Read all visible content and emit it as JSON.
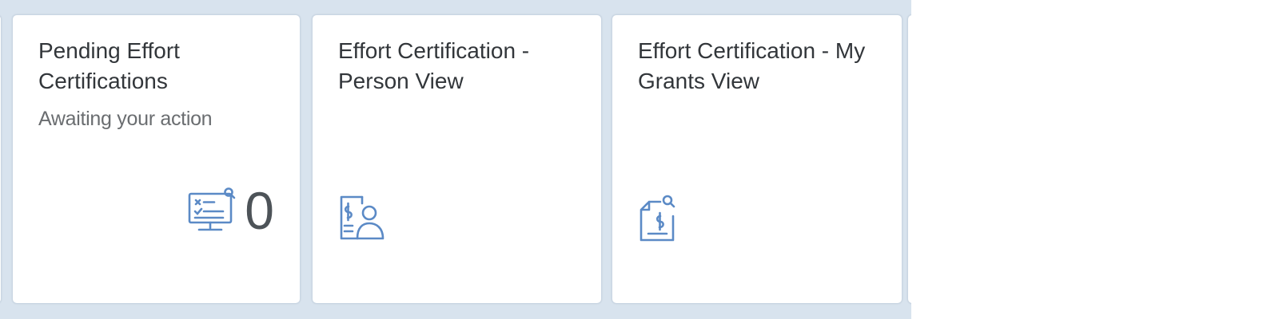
{
  "theme": {
    "accent": "#5b8ac6",
    "tile_area_bg": "#d8e3ee",
    "text": "#32363a"
  },
  "tiles": [
    {
      "title": "Pending Effort Certifications",
      "subtitle": "Awaiting your action",
      "kpi": "0",
      "icon": "monitor-checklist-icon"
    },
    {
      "title": "Effort Certification - Person View",
      "icon": "person-dollar-document-icon"
    },
    {
      "title": "Effort Certification - My Grants View",
      "icon": "dollar-document-search-icon"
    }
  ]
}
